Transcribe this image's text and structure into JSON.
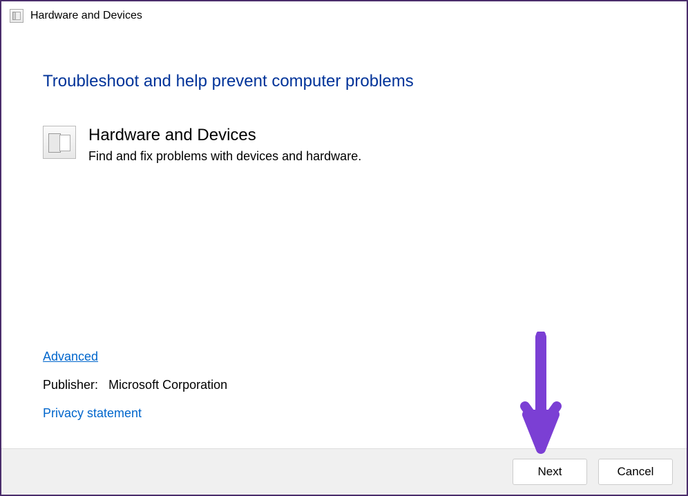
{
  "window": {
    "title": "Hardware and Devices"
  },
  "main": {
    "heading": "Troubleshoot and help prevent computer problems",
    "troubleshooter": {
      "title": "Hardware and Devices",
      "description": "Find and fix problems with devices and hardware."
    },
    "advanced_link": "Advanced",
    "publisher_label": "Publisher:",
    "publisher_value": "Microsoft Corporation",
    "privacy_link": "Privacy statement"
  },
  "buttons": {
    "next": "Next",
    "cancel": "Cancel"
  },
  "annotation": {
    "arrow_color": "#7b3fd4"
  }
}
